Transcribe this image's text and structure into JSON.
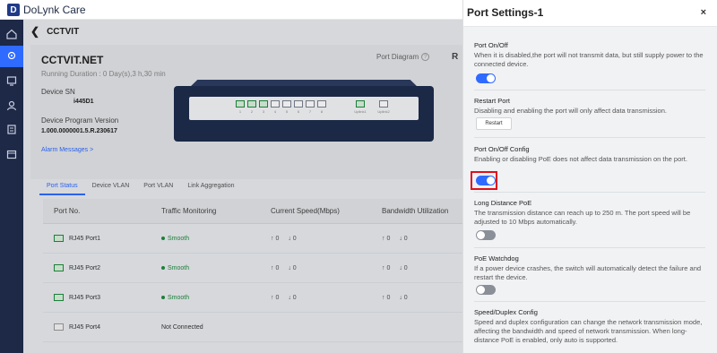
{
  "app": {
    "logo_mark": "D",
    "name": "DoLynk Care"
  },
  "breadcrumb": {
    "title": "CCTVIT"
  },
  "device": {
    "site_name": "CCTVIT.NET",
    "running": "Running Duration :  0 Day(s),3 h,30 min",
    "sn_label": "Device SN",
    "sn_value": "i445D1",
    "program_label": "Device Program Version",
    "program_value": "1.000.0000001.5.R.230617",
    "alarm": "Alarm Messages >",
    "port_diagram": "Port Diagram",
    "right_cut": "R"
  },
  "switch": {
    "ports": [
      {
        "num": "1",
        "on": true
      },
      {
        "num": "2",
        "on": true
      },
      {
        "num": "3",
        "on": true
      },
      {
        "num": "4",
        "on": false
      },
      {
        "num": "5",
        "on": false
      },
      {
        "num": "6",
        "on": false
      },
      {
        "num": "7",
        "on": false
      },
      {
        "num": "8",
        "on": false
      }
    ],
    "uplinks": [
      {
        "num": "Uplink1",
        "on": true
      },
      {
        "num": "Uplink2",
        "on": false
      }
    ]
  },
  "tabs": [
    "Port Status",
    "Device VLAN",
    "Port VLAN",
    "Link Aggregation"
  ],
  "table": {
    "headers": [
      "Port No.",
      "Traffic Monitoring",
      "Current Speed(Mbps)",
      "Bandwidth Utilization"
    ],
    "rows": [
      {
        "port": "RJ45 Port1",
        "status": "Smooth",
        "up": "↑ 0",
        "down": "↓ 0",
        "bw_up": "↑ 0",
        "bw_down": "↓ 0"
      },
      {
        "port": "RJ45 Port2",
        "status": "Smooth",
        "up": "↑ 0",
        "down": "↓ 0",
        "bw_up": "↑ 0",
        "bw_down": "↓ 0"
      },
      {
        "port": "RJ45 Port3",
        "status": "Smooth",
        "up": "↑ 0",
        "down": "↓ 0",
        "bw_up": "↑ 0",
        "bw_down": "↓ 0"
      },
      {
        "port": "RJ45 Port4",
        "status": "Not Connected",
        "up": "",
        "down": "",
        "bw_up": "",
        "bw_down": ""
      }
    ]
  },
  "drawer": {
    "title": "Port Settings-1",
    "close": "×",
    "sections": {
      "onoff": {
        "title": "Port On/Off",
        "desc": "When it is disabled,the port will not transmit data, but still supply power to the connected device."
      },
      "restart": {
        "title": "Restart Port",
        "desc": "Disabling and enabling the port will only affect data transmission.",
        "button": "Restart"
      },
      "onoff_config": {
        "title": "Port On/Off Config",
        "desc": "Enabling or disabling PoE does not affect data transmission on the port."
      },
      "long_poe": {
        "title": "Long Distance PoE",
        "desc": "The transmission distance can reach up to 250 m. The port speed will be adjusted to 10 Mbps automatically."
      },
      "watchdog": {
        "title": "PoE Watchdog",
        "desc": "If a power device crashes, the switch will automatically detect the failure and restart the device."
      },
      "speed": {
        "title": "Speed/Duplex Config",
        "desc": "Speed and duplex configuration can change the network transmission mode, affecting the bandwidth and speed of network transmission. When long-distance PoE is enabled, only auto is supported."
      }
    },
    "toggles": {
      "onoff": true,
      "onoff_config": true,
      "long_poe": false,
      "watchdog": false
    }
  },
  "colors": {
    "accent": "#2f6bff",
    "nav": "#1e2847",
    "ok": "#1f8a3e",
    "highlight": "#e0101a"
  }
}
